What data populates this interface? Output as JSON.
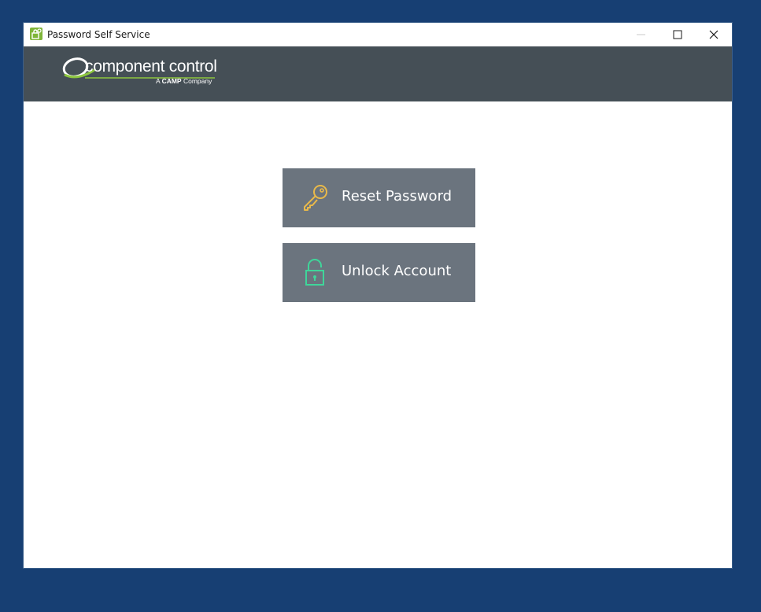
{
  "window": {
    "title": "Password Self Service"
  },
  "header": {
    "logo_main": "component control",
    "logo_sub_prefix": "A ",
    "logo_sub_bold": "CAMP",
    "logo_sub_suffix": " Company"
  },
  "actions": {
    "reset_label": "Reset Password",
    "unlock_label": "Unlock Account"
  },
  "icons": {
    "app": "key-lock-app-icon",
    "reset": "key-icon",
    "unlock": "padlock-open-icon",
    "minimize": "minimize-icon",
    "maximize": "maximize-icon",
    "close": "close-icon"
  },
  "colors": {
    "desktop": "#173f73",
    "header": "#454f56",
    "button": "#6b747e",
    "key": "#e9b94a",
    "lock": "#3fd69a",
    "logo_green": "#8dc63f"
  }
}
